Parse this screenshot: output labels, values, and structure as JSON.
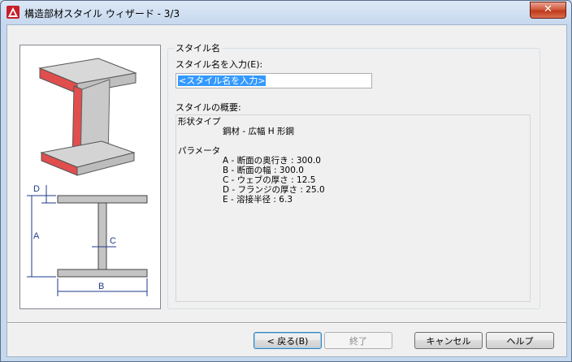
{
  "window": {
    "title": "構造部材スタイル ウィザード - 3/3",
    "close_glyph": "✕"
  },
  "form": {
    "group_title": "スタイル名",
    "name_label": "スタイル名を入力(E):",
    "name_value": "<スタイル名を入力>",
    "summary_label": "スタイルの概要:"
  },
  "summary": {
    "shape_type_label": "形状タイプ",
    "shape_type_value": "鋼材 - 広幅 H 形鋼",
    "params_label": "パラメータ",
    "params": [
      "A - 断面の奥行き : 300.0",
      "B - 断面の幅 : 300.0",
      "C - ウェブの厚さ : 12.5",
      "D - フランジの厚さ : 25.0",
      "E - 溶接半径 : 6.3"
    ]
  },
  "diagram": {
    "labels": {
      "a": "A",
      "b": "B",
      "c": "C",
      "d": "D"
    }
  },
  "buttons": {
    "back": "< 戻る(B)",
    "finish": "終了",
    "cancel": "キャンセル",
    "help": "ヘルプ"
  },
  "colors": {
    "accent_red": "#c8202a",
    "flange_red": "#e04e4e",
    "steel_gray": "#bdbdbd"
  }
}
